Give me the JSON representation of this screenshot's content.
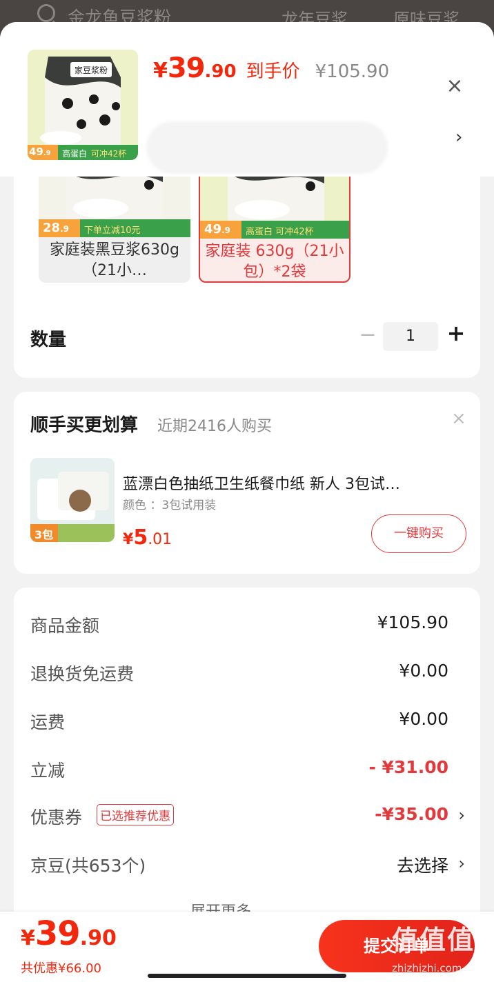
{
  "background": {
    "search_query": "金龙鱼豆浆粉",
    "tab_1": "龙年豆浆",
    "tab_2": "原味豆浆"
  },
  "header": {
    "currency": "¥",
    "price_int": "39",
    "price_dec": ".90",
    "net_price_label": "到手价",
    "original_price": "¥105.90",
    "close": "×",
    "chevron": "›",
    "thumb_badge_price": "49",
    "thumb_badge_price_dec": ".9",
    "thumb_tag_1": "高蛋白",
    "thumb_tag_2": "可冲42杯"
  },
  "spec_options": [
    {
      "label": "家庭装黑豆浆630g（21小…",
      "badge_price": "28",
      "badge_dec": ".9",
      "promo": "下单立减10元"
    },
    {
      "label": "家庭装 630g（21小包）*2袋",
      "badge_price": "49",
      "badge_dec": ".9",
      "promo": "高蛋白 可冲42杯"
    }
  ],
  "quantity": {
    "label": "数量",
    "minus": "−",
    "value": "1",
    "plus": "+"
  },
  "bundle": {
    "title": "顺手买更划算",
    "subtitle": "近期2416人购买",
    "close": "×",
    "product_name": "蓝漂白色抽纸卫生纸餐巾纸  新人  3包试…",
    "attr": "颜色 ：3包试用装",
    "currency": "¥",
    "price_int": "5",
    "price_dec": ".01",
    "buy_button": "一键购买",
    "img_badge": "3包"
  },
  "summary": {
    "rows": [
      {
        "label": "商品金额",
        "value": "¥105.90"
      },
      {
        "label": "退换货免运费",
        "value": "¥0.00"
      },
      {
        "label": "运费",
        "value": "¥0.00"
      },
      {
        "label": "立减",
        "value": "- ¥31.00"
      },
      {
        "label": "优惠券",
        "tag": "已选推荐优惠",
        "value": "-¥35.00"
      },
      {
        "label": "京豆(共653个)",
        "value": "去选择"
      }
    ],
    "expand_more": "展开更多 ⌄"
  },
  "bottom": {
    "currency": "¥",
    "total_int": "39",
    "total_dec": ".90",
    "saved": "共优惠¥66.00",
    "submit": "提交订单"
  },
  "watermark": {
    "logo": "值值值",
    "site": "zhizhizhi.com"
  },
  "colors": {
    "accent_red": "#f2270c",
    "border_red": "#e4393c",
    "background": "#f2f2f2"
  }
}
